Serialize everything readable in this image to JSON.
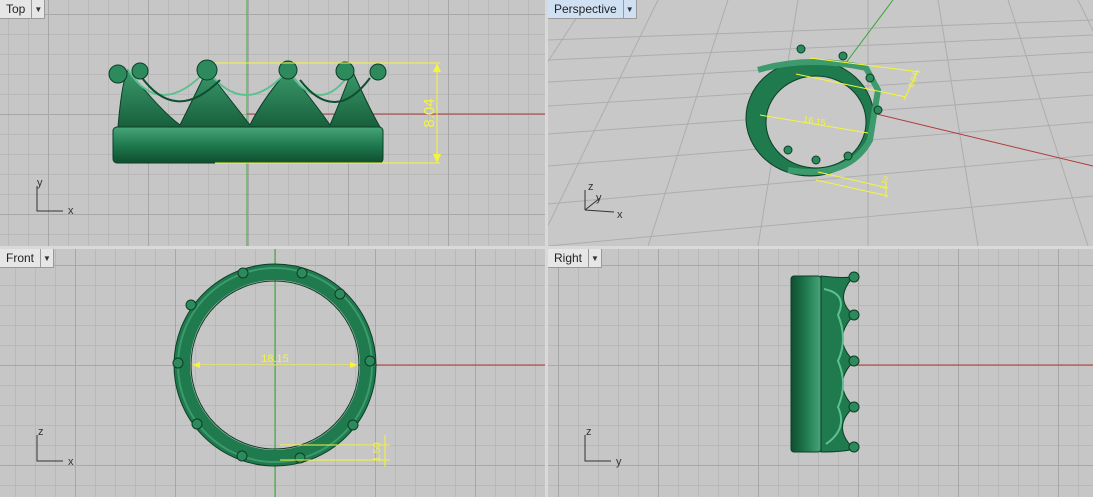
{
  "viewports": {
    "top": {
      "label": "Top",
      "dimension": "8.04",
      "axes": {
        "vertical": "y",
        "horizontal": "x"
      }
    },
    "persp": {
      "label": "Perspective",
      "dimension_diameter": "16.15",
      "dimension_height": "8.04",
      "dimension_band": "1.50",
      "axes": {
        "z": "z",
        "y": "y",
        "x": "x"
      }
    },
    "front": {
      "label": "Front",
      "dimension_diameter": "18.15",
      "dimension_band": "1.50",
      "axes": {
        "vertical": "z",
        "horizontal": "x"
      }
    },
    "right": {
      "label": "Right",
      "axes": {
        "vertical": "z",
        "horizontal": "y"
      }
    }
  },
  "colors": {
    "model": "#1f7a4e",
    "dimension": "#f5f53a",
    "x_axis": "#b23b3b",
    "y_axis": "#3aa83a",
    "active_tab": "#cfe0f3"
  },
  "icons": {
    "tab_menu": "chevron-down-icon"
  }
}
